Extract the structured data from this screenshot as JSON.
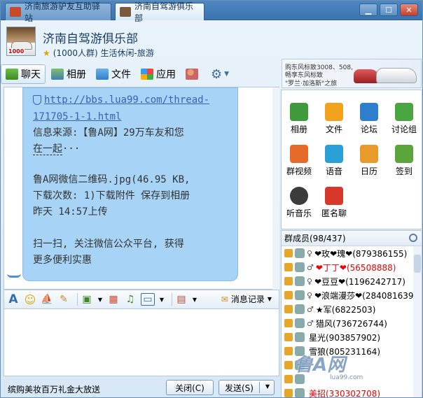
{
  "tabs": [
    {
      "label": "济南旅游驴友互助驿站"
    },
    {
      "label": "济南自驾游俱乐部"
    }
  ],
  "window_buttons": [
    "minimize",
    "maximize",
    "close"
  ],
  "header": {
    "group_name": "济南自驾游俱乐部",
    "group_info": "(1000人群) 生活休闲-旅游",
    "avatar_tag": "1000"
  },
  "toolbar": {
    "chat": "聊天",
    "album": "相册",
    "files": "文件",
    "apps": "应用"
  },
  "banner": {
    "line1": "购东风标致3008、508,",
    "line2": "畅享东风标致",
    "line3": "\"罗兰·加洛斯\"之旅"
  },
  "chat": {
    "link_line1": "http://bbs.lua99.com/thread-",
    "link_line2": "171705-1-1.html",
    "source_line1": "信息来源:【鲁A网】29万车友和您",
    "source_line2_a": "在一起",
    "source_line2_b": "···",
    "file_line1": "鲁A网微信二维码.jpg(46.95 KB,",
    "file_line2": "下载次数: 1)下载附件 保存到相册",
    "file_line3": "昨天 14:57上传",
    "promo_line1": "扫一扫, 关注微信公众平台, 获得",
    "promo_line2": "更多便利实惠"
  },
  "input_toolbar": {
    "message_record": "消息记录"
  },
  "bottom": {
    "ad_text": "缤购美妆百万礼金大放送",
    "close_label": "关闭(C)",
    "send_label": "发送(S)"
  },
  "apps": [
    {
      "label": "相册",
      "color": "#3e9a3a"
    },
    {
      "label": "文件",
      "color": "#f1a21a"
    },
    {
      "label": "论坛",
      "color": "#2f7fd0"
    },
    {
      "label": "讨论组",
      "color": "#4aa640"
    },
    {
      "label": "群视频",
      "color": "#e66a2a"
    },
    {
      "label": "语音",
      "color": "#2aa0d8"
    },
    {
      "label": "日历",
      "color": "#e89a2a"
    },
    {
      "label": "签到",
      "color": "#5aa63a"
    },
    {
      "label": "听音乐",
      "color": "#3b3b3b"
    },
    {
      "label": "匿名聊",
      "color": "#d8382a"
    }
  ],
  "members": {
    "header": "群成员(98/437)",
    "list": [
      {
        "gender": "♀",
        "name": "❤玫❤瑰❤(879386155)",
        "highlight": false
      },
      {
        "gender": "♂",
        "name": "❤丁丁❤(56508888)",
        "highlight": true
      },
      {
        "gender": "♀",
        "name": "❤豆豆❤(1196242717)",
        "highlight": false
      },
      {
        "gender": "♀",
        "name": "❤浪端漫莎❤(284081639)",
        "highlight": false
      },
      {
        "gender": "♂",
        "name": "★军(6822503)",
        "highlight": false
      },
      {
        "gender": "♂",
        "name": "猎风(736726744)",
        "highlight": false
      },
      {
        "gender": "",
        "name": "星光(903857902)",
        "highlight": false
      },
      {
        "gender": "",
        "name": "雪狼(805231164)",
        "highlight": false
      },
      {
        "gender": "",
        "name": "",
        "highlight": false
      },
      {
        "gender": "",
        "name": "",
        "highlight": false
      },
      {
        "gender": "",
        "name": "美招(330302708)",
        "highlight": true
      }
    ]
  },
  "watermark": {
    "text": "鲁A网",
    "url": "lua99.com"
  }
}
